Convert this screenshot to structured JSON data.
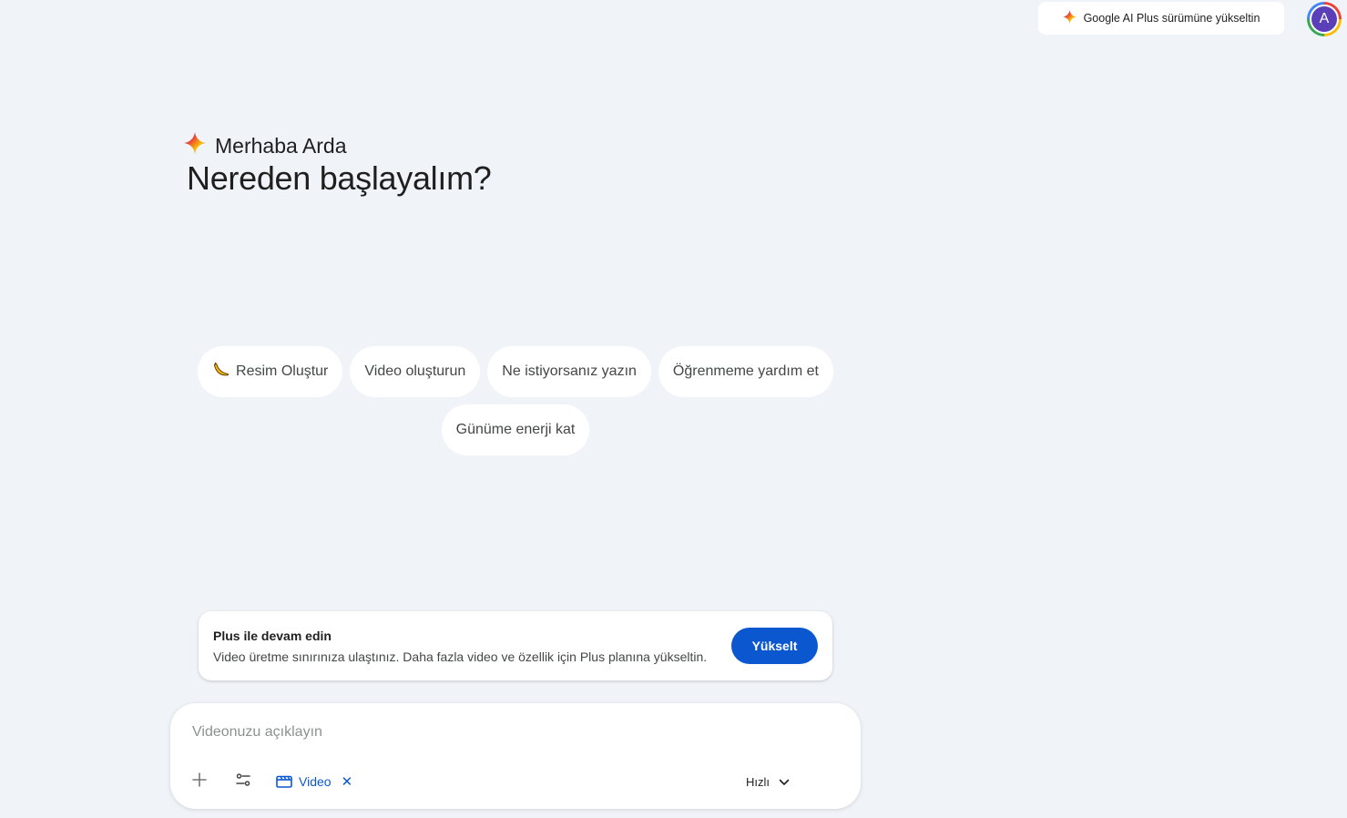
{
  "header": {
    "upgrade_label": "Google AI Plus sürümüne yükseltin",
    "avatar_initial": "A"
  },
  "hero": {
    "greeting": "Merhaba Arda",
    "headline": "Nereden başlayalım?"
  },
  "chips": [
    {
      "label": "Resim Oluştur",
      "icon": "banana-icon"
    },
    {
      "label": "Video oluşturun"
    },
    {
      "label": "Ne istiyorsanız yazın"
    },
    {
      "label": "Öğrenmeme yardım et"
    },
    {
      "label": "Günüme enerji kat"
    }
  ],
  "notice": {
    "title": "Plus ile devam edin",
    "description": "Video üretme sınırınıza ulaştınız. Daha fazla video ve özellik için Plus planına yükseltin.",
    "button_label": "Yükselt"
  },
  "composer": {
    "placeholder": "Videonuzu açıklayın",
    "tool_label": "Video",
    "speed_label": "Hızlı"
  },
  "colors": {
    "background": "#f0f4f9",
    "accent": "#0b57d0",
    "avatar": "#5b3fb8"
  }
}
